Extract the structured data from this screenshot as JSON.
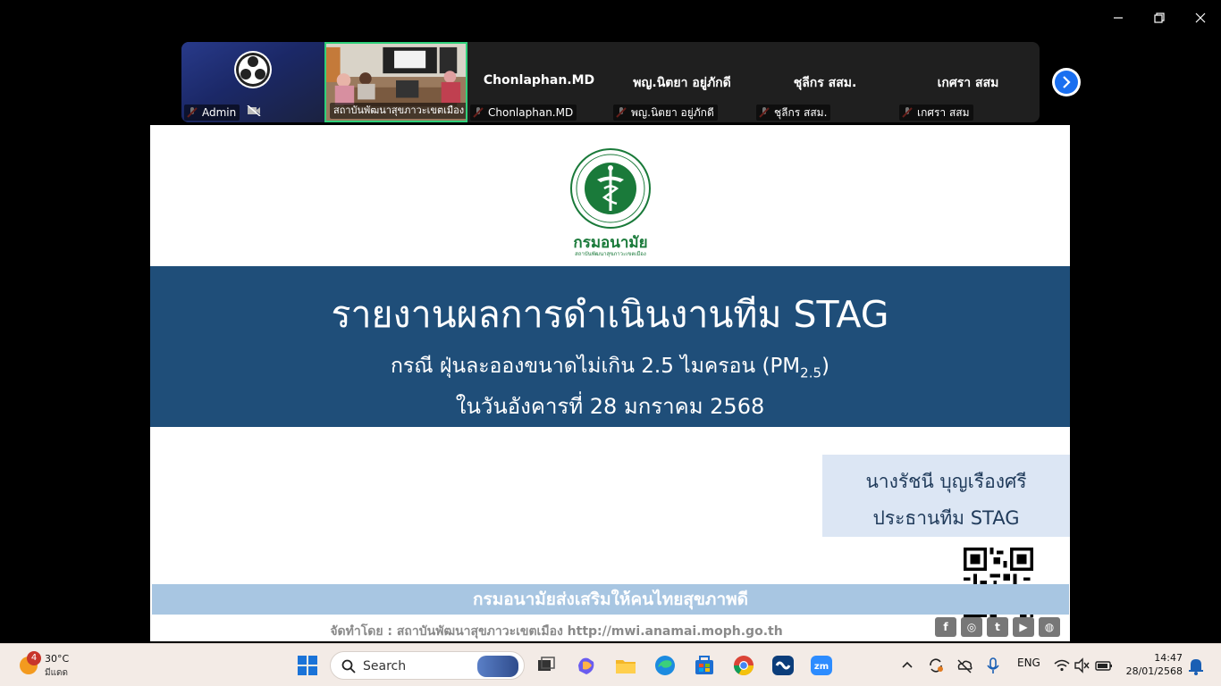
{
  "participants": [
    {
      "name": "Admin",
      "display": ""
    },
    {
      "name": "สถาบันพัฒนาสุขภาวะเขตเมือง",
      "display": ""
    },
    {
      "name": "Chonlaphan.MD",
      "display": "Chonlaphan.MD"
    },
    {
      "name": "พญ.นิตยา อยู่ภักดี",
      "display": "พญ.นิตยา อยู่ภักดี"
    },
    {
      "name": "ชุลีกร สสม.",
      "display": "ชุลีกร สสม."
    },
    {
      "name": "เกศรา สสม",
      "display": "เกศรา สสม"
    }
  ],
  "slide": {
    "org_name": "กรมอนามัย",
    "org_sub": "สถาบันพัฒนาสุขภาวะเขตเมือง",
    "title": "รายงานผลการดำเนินงานทีม STAG",
    "subtitle_main": "กรณี ฝุ่นละอองขนาดไม่เกิน 2.5 ไมครอน (PM",
    "subtitle_sub": "2.5",
    "subtitle_end": ")",
    "date_line": "ในวันอังคารที่ 28 มกราคม 2568",
    "presenter_name": "นางรัชนี บุญเรืองศรี",
    "presenter_role": "ประธานทีม STAG",
    "footer_slogan": "กรมอนามัยส่งเสริมให้คนไทยสุขภาพดี",
    "footer_credit": "จัดทำโดย : สถาบันพัฒนาสุขภาวะเขตเมือง http://mwi.anamai.moph.go.th",
    "socials": [
      "f",
      "◎",
      "t",
      "▶",
      "◍"
    ]
  },
  "taskbar": {
    "weather_badge": "4",
    "weather_temp": "30°C",
    "weather_cond": "มีแดด",
    "search_label": "Search",
    "lang": "ENG",
    "time": "14:47",
    "date": "28/01/2568"
  },
  "colors": {
    "slide_band": "#1f4e79",
    "presenter_box": "#dce6f4",
    "footer_band": "#a8c6e2",
    "active_speaker": "#2fd07a",
    "taskbar_bg": "#f3ebe6"
  }
}
